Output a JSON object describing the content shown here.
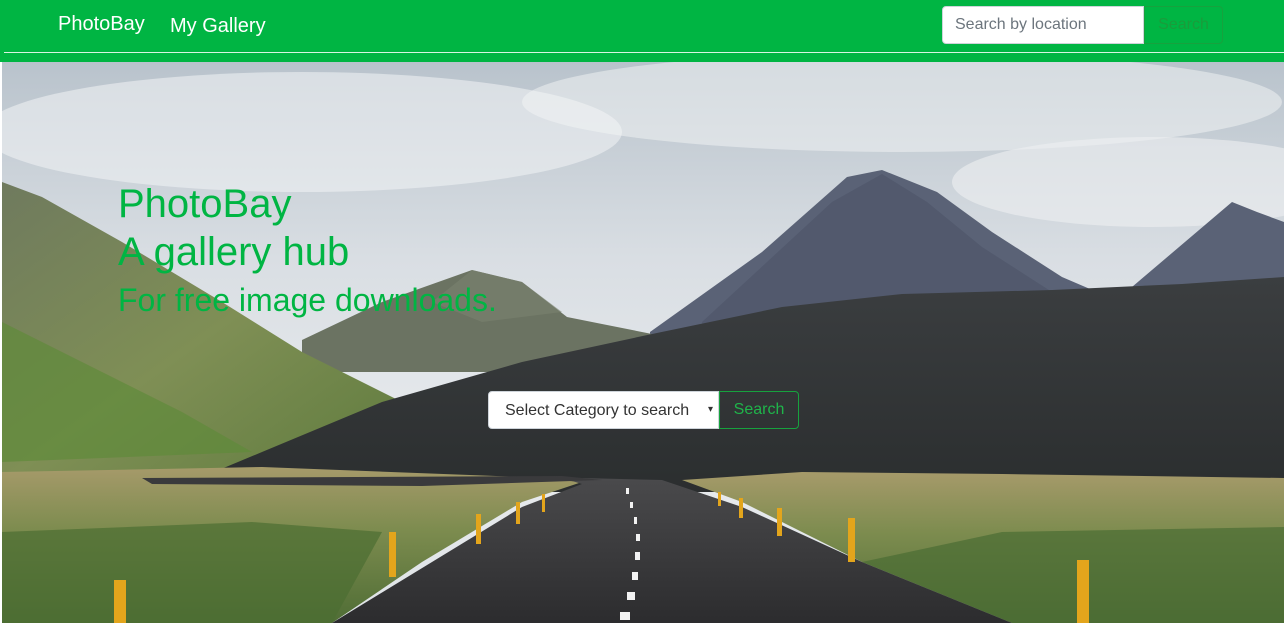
{
  "navbar": {
    "brand": "PhotoBay",
    "links": [
      {
        "label": "My Gallery"
      }
    ],
    "location_search": {
      "placeholder": "Search by location",
      "value": ""
    },
    "search_button_label": "Search"
  },
  "hero": {
    "background": "mountain-road-landscape",
    "title": "PhotoBay",
    "subtitle": "A gallery hub",
    "tagline": "For free image downloads.",
    "category_select": {
      "selected": "Select Category to search"
    },
    "search_button_label": "Search"
  },
  "colors": {
    "brand_green": "#00b543",
    "button_border": "#17a23e"
  },
  "icons": {
    "select_caret": "▾"
  }
}
